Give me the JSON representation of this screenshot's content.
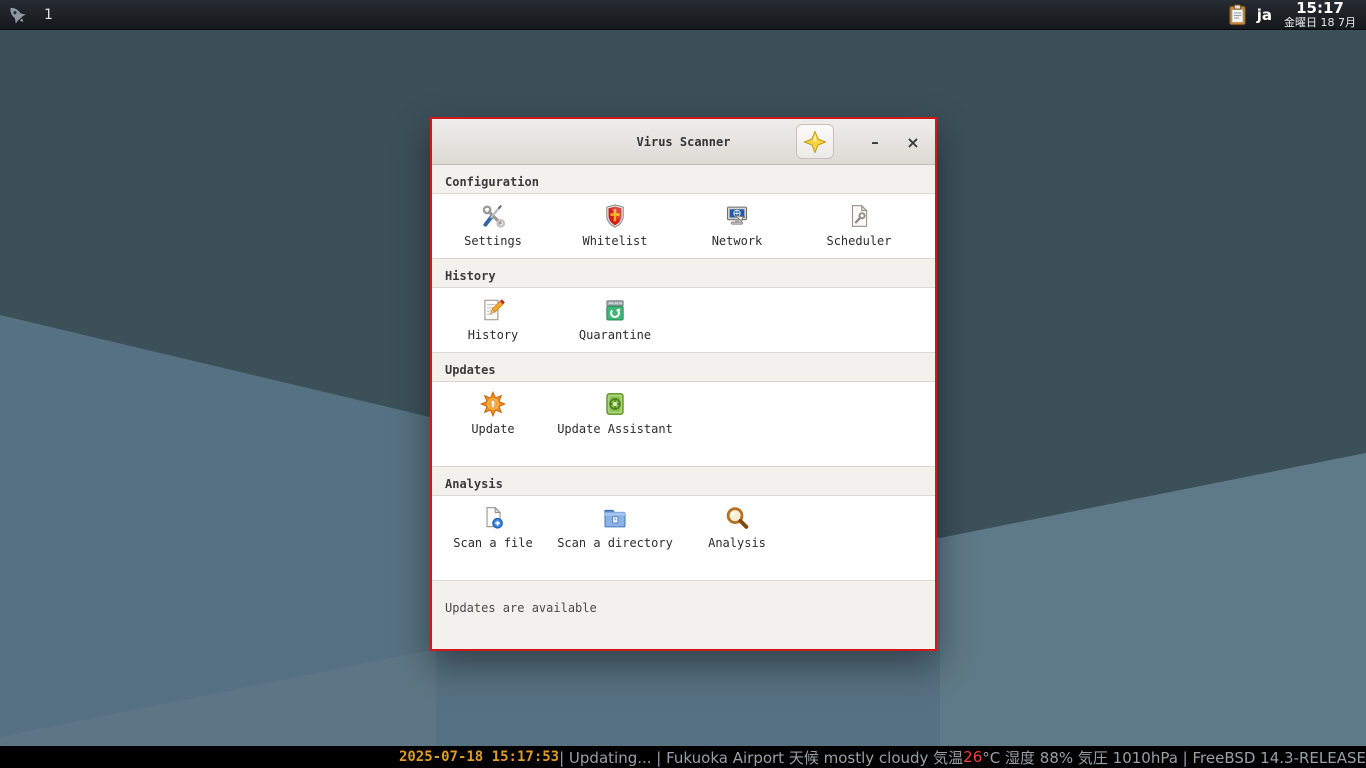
{
  "colors": {
    "window_border": "#d21717",
    "wallpaper_dark": "#3c505a",
    "wallpaper_mid": "#567181",
    "wallpaper_light": "#5e7987",
    "status_date": "#e09c25",
    "status_alert": "#f23d3d",
    "status_text": "#97a0a4",
    "accent_blue": "#3465a4"
  },
  "panel": {
    "launcher_icon": "rocket-icon",
    "workspace_label": "1",
    "tray": {
      "clipboard_icon": "clipboard-icon",
      "language": "ja",
      "time": "15:17",
      "date": "金曜日 18 7月"
    }
  },
  "window": {
    "title": "Virus Scanner",
    "controls": {
      "sparkle_icon": "sparkle-icon",
      "minimize_glyph": "–",
      "close_glyph": "×"
    },
    "sections": [
      {
        "label": "Configuration",
        "items": [
          {
            "label": "Settings",
            "icon": "settings-icon"
          },
          {
            "label": "Whitelist",
            "icon": "whitelist-icon"
          },
          {
            "label": "Network",
            "icon": "network-icon"
          },
          {
            "label": "Scheduler",
            "icon": "scheduler-icon"
          }
        ]
      },
      {
        "label": "History",
        "items": [
          {
            "label": "History",
            "icon": "history-icon"
          },
          {
            "label": "Quarantine",
            "icon": "quarantine-icon"
          }
        ]
      },
      {
        "label": "Updates",
        "items": [
          {
            "label": "Update",
            "icon": "update-icon"
          },
          {
            "label": "Update Assistant",
            "icon": "update-assistant-icon"
          }
        ]
      },
      {
        "label": "Analysis",
        "items": [
          {
            "label": "Scan a file",
            "icon": "scan-file-icon"
          },
          {
            "label": "Scan a directory",
            "icon": "scan-directory-icon"
          },
          {
            "label": "Analysis",
            "icon": "analysis-icon"
          }
        ]
      }
    ],
    "status": "Updates are available"
  },
  "statusbar": {
    "segments": [
      {
        "text": "2025-07-18 15:17:53"
      },
      {
        "text": " | Updating... | Fukuoka Airport 天候 mostly cloudy 気温 "
      },
      {
        "text": "26"
      },
      {
        "text": "°C 湿度 88% 気圧 1010hPa | FreeBSD 14.3-RELEASE "
      }
    ]
  }
}
